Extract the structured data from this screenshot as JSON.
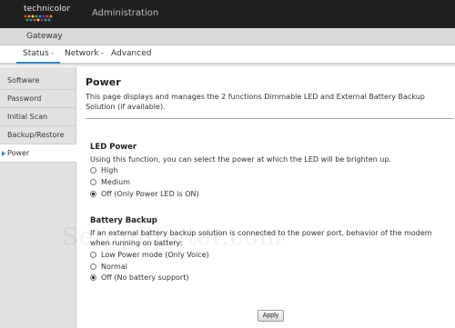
{
  "header": {
    "logo_text": "technicolor",
    "title": "Administration"
  },
  "gateway": {
    "label": "Gateway"
  },
  "tabs": [
    {
      "label": "Status",
      "caret": "-",
      "active": true
    },
    {
      "label": "Network",
      "caret": "-"
    },
    {
      "label": "Advanced"
    }
  ],
  "sidebar": {
    "items": [
      {
        "label": "Software"
      },
      {
        "label": "Password"
      },
      {
        "label": "Initial Scan"
      },
      {
        "label": "Backup/Restore"
      },
      {
        "label": "Power",
        "active": true
      }
    ]
  },
  "main": {
    "title": "Power",
    "description": "This page displays and manages the 2 functions Dimmable LED and External Battery Backup Solution (if available).",
    "led": {
      "title": "LED Power",
      "description": "Using this function, you can select the power at which the LED will be brighten up.",
      "options": [
        "High",
        "Medium",
        "Off (Only Power LED is ON)"
      ],
      "selected": "Off (Only Power LED is ON)"
    },
    "battery": {
      "title": "Battery Backup",
      "description": "If an external battery backup solution is connected to the power port, behavior of the modem when running on battery:",
      "options": [
        "Low Power mode (Only Voice)",
        "Normal",
        "Off (No battery support)"
      ],
      "selected": "Off (No battery support)"
    },
    "apply_label": "Apply"
  },
  "watermark": "SetupRouter.com",
  "colors": {
    "accent": "#2e8bc9",
    "header_bg": "#1f1f1f",
    "sidebar_bg": "#e2e2e2"
  }
}
